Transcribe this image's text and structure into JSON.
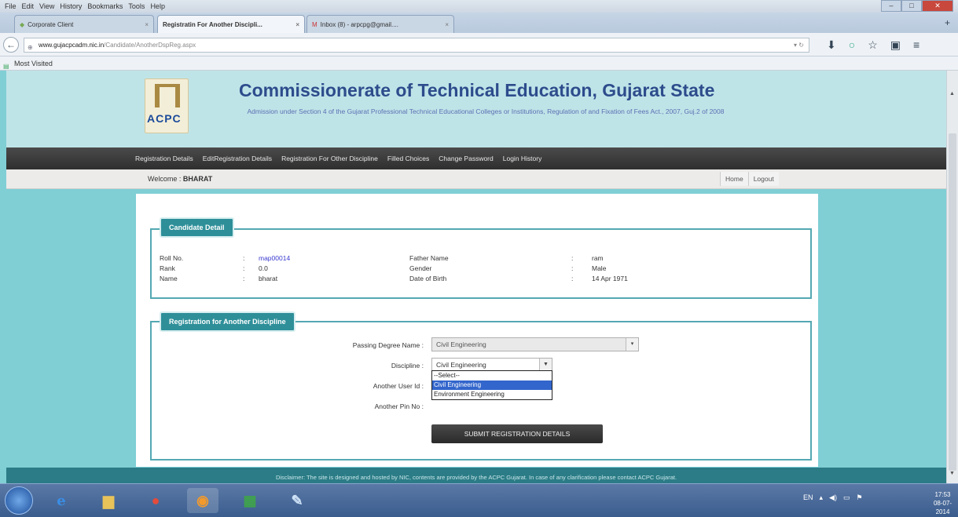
{
  "browser": {
    "menu": [
      "File",
      "Edit",
      "View",
      "History",
      "Bookmarks",
      "Tools",
      "Help"
    ],
    "tabs": [
      {
        "label": "Corporate Client",
        "active": false
      },
      {
        "label": "Registratin For Another Discipli...",
        "active": true
      },
      {
        "label": "Inbox (8) - arpcpg@gmail....",
        "active": false
      }
    ],
    "url_domain": "www.gujacpcadm.nic.in",
    "url_path": "/Candidate/AnotherDspReg.aspx",
    "bookmarks": [
      "Most Visited"
    ]
  },
  "site": {
    "logo_text": "ACPC",
    "title": "Commissionerate of Technical Education, Gujarat State",
    "subtitle": "Admission under Section 4 of the Gujarat Professional Technical Educational Colleges or Institutions, Regulation of and Fixation of Fees Act., 2007, Guj.2 of 2008",
    "nav": [
      "Registration Details",
      "EditRegistration Details",
      "Registration For Other Discipline",
      "Filled Choices",
      "Change Password",
      "Login History"
    ],
    "welcome_label": "Welcome :",
    "welcome_user": "BHARAT",
    "top_links": [
      "Home",
      "Logout"
    ]
  },
  "candidate": {
    "legend": "Candidate Detail",
    "fields": [
      {
        "label": "Roll No.",
        "value": "map00014",
        "label2": "Father Name",
        "value2": "ram"
      },
      {
        "label": "Rank",
        "value": "0.0",
        "label2": "Gender",
        "value2": "Male"
      },
      {
        "label": "Name",
        "value": "bharat",
        "label2": "Date of Birth",
        "value2": "14 Apr 1971"
      }
    ],
    "sep": ":"
  },
  "registration": {
    "legend": "Registration for Another Discipline",
    "passing_degree_label": "Passing Degree Name :",
    "passing_degree_value": "Civil Engineering",
    "discipline_label": "Discipline :",
    "discipline_value": "Civil Engineering",
    "discipline_options": [
      "--Select--",
      "Civil Engineering",
      "Environment Engineering"
    ],
    "discipline_selected_index": 1,
    "another_user_label": "Another User Id :",
    "another_pin_label": "Another Pin No :",
    "submit_label": "SUBMIT REGISTRATION DETAILS"
  },
  "footer": {
    "disclaimer": "Disclaimer: The site is designed and hosted by NIC, contents are provided by the ACPC Gujarat. In case of any clarification please contact ACPC Gujarat."
  },
  "taskbar": {
    "lang": "EN",
    "time": "17:53",
    "date": "08-07-2014"
  }
}
